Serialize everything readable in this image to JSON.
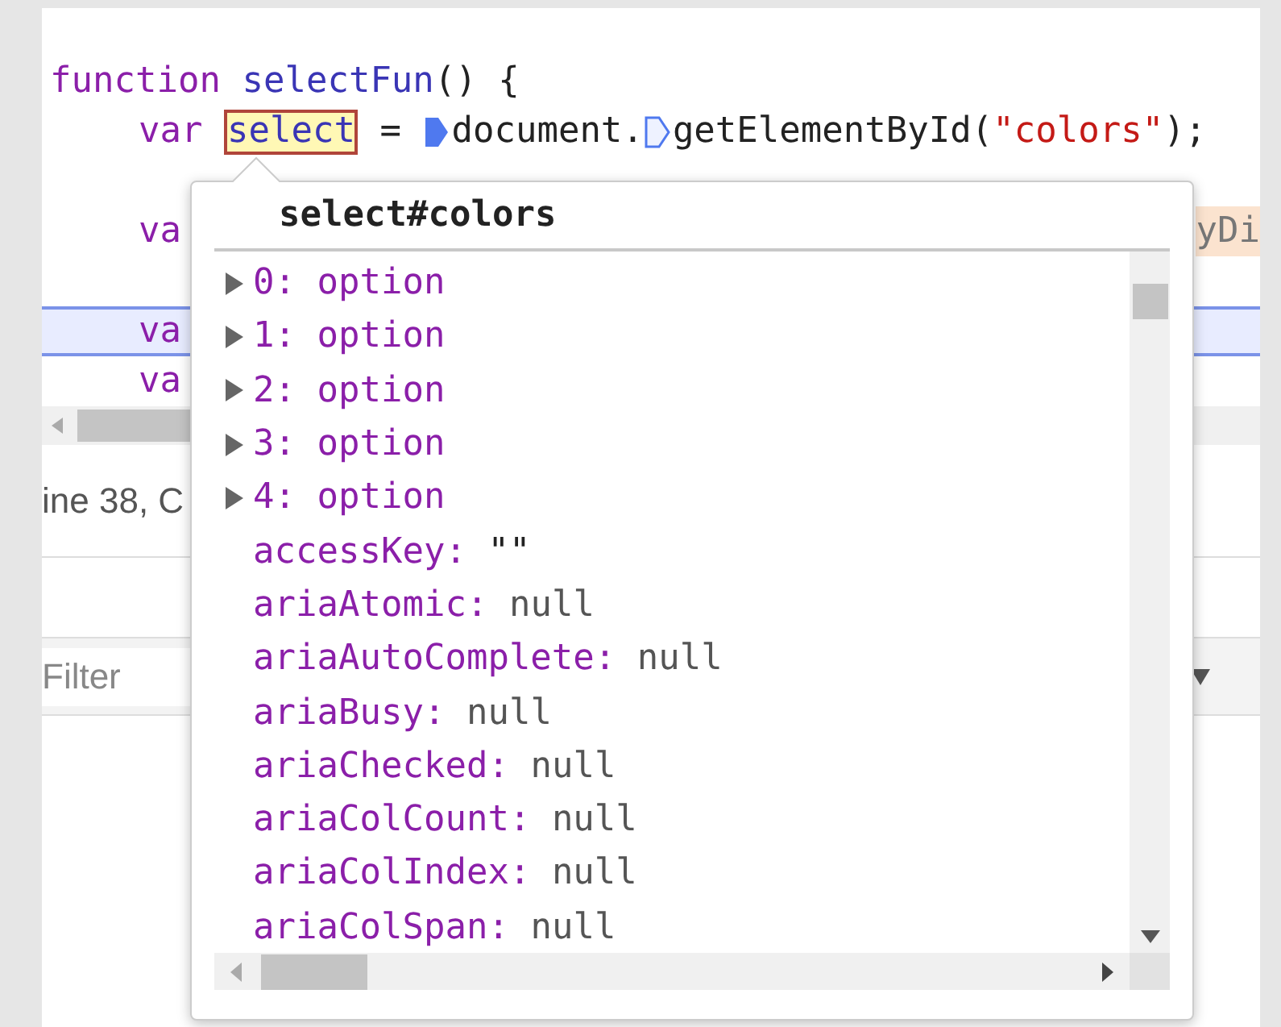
{
  "editor": {
    "header": [
      {
        "kind": "keyword",
        "text": "function "
      },
      {
        "kind": "function",
        "text": "selectFun"
      },
      {
        "kind": "plain",
        "text": "() {"
      }
    ],
    "lines": [
      {
        "selected": false,
        "segments": [
          {
            "kind": "keyword",
            "text": "var "
          },
          {
            "kind": "highlight",
            "text": "select"
          },
          {
            "kind": "operator",
            "text": " = "
          },
          {
            "kind": "breakpoint",
            "on": true
          },
          {
            "kind": "plain",
            "text": "document."
          },
          {
            "kind": "breakpoint",
            "on": false
          },
          {
            "kind": "plain",
            "text": "getElementById("
          },
          {
            "kind": "string",
            "text": "\"colors\""
          },
          {
            "kind": "plain",
            "text": ");"
          }
        ]
      },
      {
        "selected": false
      },
      {
        "selected": false,
        "segments": [
          {
            "kind": "keyword",
            "text": "va"
          },
          {
            "kind": "hint",
            "text": "yDi"
          }
        ]
      },
      {
        "selected": false
      },
      {
        "selected": true,
        "segments": [
          {
            "kind": "keyword",
            "text": "va"
          }
        ]
      },
      {
        "selected": false,
        "segments": [
          {
            "kind": "keyword",
            "text": "va"
          }
        ]
      }
    ]
  },
  "status": "ine 38, C",
  "filter": {
    "placeholder": "Filter"
  },
  "popover": {
    "title": "select#colors",
    "properties": [
      {
        "kind": "expandable",
        "expanded": false,
        "name": "0:",
        "value": "option"
      },
      {
        "kind": "expandable",
        "expanded": false,
        "name": "1:",
        "value": "option"
      },
      {
        "kind": "expandable",
        "expanded": false,
        "name": "2:",
        "value": "option"
      },
      {
        "kind": "expandable",
        "expanded": false,
        "name": "3:",
        "value": "option"
      },
      {
        "kind": "expandable",
        "expanded": false,
        "name": "4:",
        "value": "option"
      },
      {
        "kind": "string",
        "name": "accessKey:",
        "value": "\"\""
      },
      {
        "kind": "null",
        "name": "ariaAtomic:",
        "value": "null"
      },
      {
        "kind": "null",
        "name": "ariaAutoComplete:",
        "value": "null"
      },
      {
        "kind": "null",
        "name": "ariaBusy:",
        "value": "null"
      },
      {
        "kind": "null",
        "name": "ariaChecked:",
        "value": "null"
      },
      {
        "kind": "null",
        "name": "ariaColCount:",
        "value": "null"
      },
      {
        "kind": "null",
        "name": "ariaColIndex:",
        "value": "null"
      },
      {
        "kind": "null",
        "name": "ariaColSpan:",
        "value": "null"
      }
    ]
  }
}
